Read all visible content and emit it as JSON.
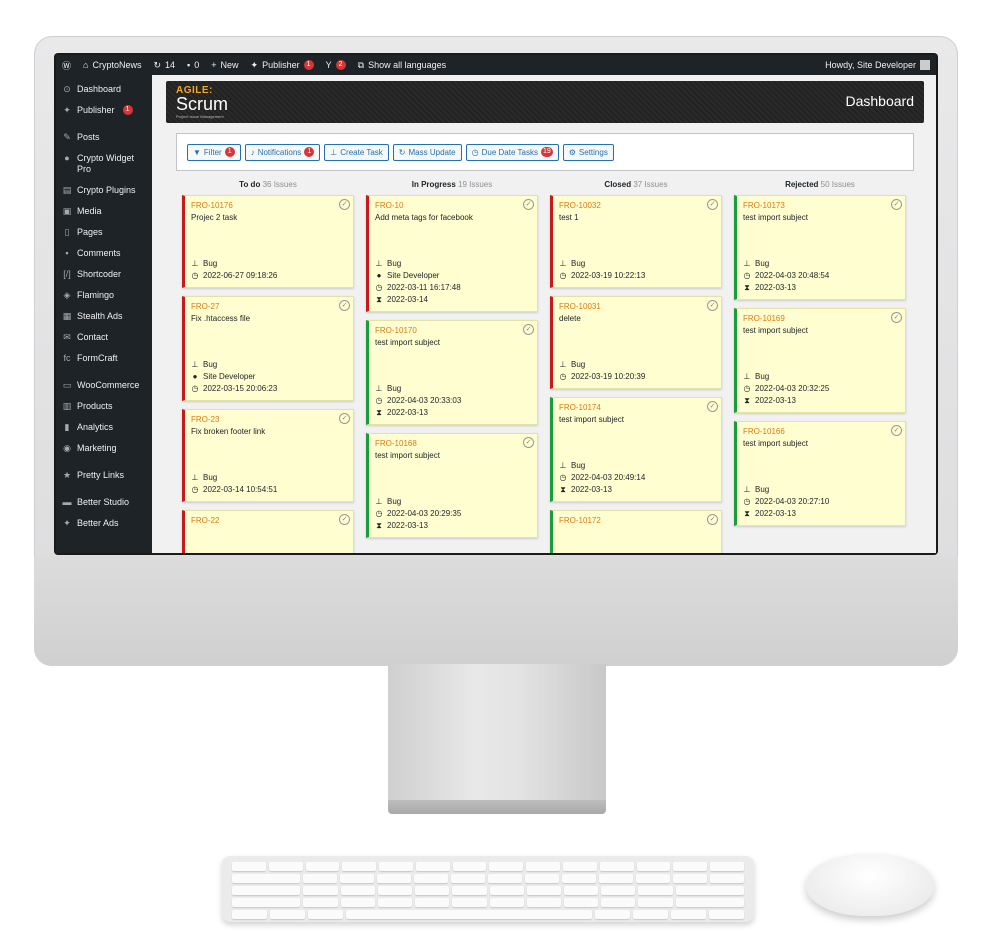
{
  "adminbar": {
    "site_name": "CryptoNews",
    "updates_count": "14",
    "comments_count": "0",
    "new_label": "New",
    "publisher_label": "Publisher",
    "publisher_badge": "1",
    "yoast_badge": "2",
    "languages_label": "Show all languages",
    "howdy": "Howdy, Site Developer"
  },
  "sidebar": {
    "items": [
      {
        "label": "Dashboard",
        "icon": "dashboard-icon",
        "glyph": "⊙"
      },
      {
        "label": "Publisher",
        "icon": "publisher-icon",
        "glyph": "✦",
        "badge": "1"
      },
      {
        "label": "Posts",
        "icon": "pin-icon",
        "glyph": "✎"
      },
      {
        "label": "Crypto Widget Pro",
        "icon": "crypto-icon",
        "glyph": "●"
      },
      {
        "label": "Crypto Plugins",
        "icon": "folder-icon",
        "glyph": "▤"
      },
      {
        "label": "Media",
        "icon": "media-icon",
        "glyph": "▣"
      },
      {
        "label": "Pages",
        "icon": "pages-icon",
        "glyph": "▯"
      },
      {
        "label": "Comments",
        "icon": "comments-icon",
        "glyph": "▪"
      },
      {
        "label": "Shortcoder",
        "icon": "shortcode-icon",
        "glyph": "[/]"
      },
      {
        "label": "Flamingo",
        "icon": "flamingo-icon",
        "glyph": "◈"
      },
      {
        "label": "Stealth Ads",
        "icon": "ads-icon",
        "glyph": "▦"
      },
      {
        "label": "Contact",
        "icon": "mail-icon",
        "glyph": "✉"
      },
      {
        "label": "FormCraft",
        "icon": "formcraft-icon",
        "glyph": "fc"
      },
      {
        "label": "WooCommerce",
        "icon": "woo-icon",
        "glyph": "▭"
      },
      {
        "label": "Products",
        "icon": "products-icon",
        "glyph": "▥"
      },
      {
        "label": "Analytics",
        "icon": "analytics-icon",
        "glyph": "▮"
      },
      {
        "label": "Marketing",
        "icon": "marketing-icon",
        "glyph": "◉"
      },
      {
        "label": "Pretty Links",
        "icon": "link-icon",
        "glyph": "★"
      },
      {
        "label": "Better Studio",
        "icon": "studio-icon",
        "glyph": "▬"
      },
      {
        "label": "Better Ads",
        "icon": "better-ads-icon",
        "glyph": "✦"
      }
    ]
  },
  "banner": {
    "logo_top": "AGILE:",
    "logo_main": "Scrum",
    "logo_sub": "Project Issue Management",
    "title": "Dashboard"
  },
  "toolbar": {
    "filter": "Filter",
    "filter_badge": "1",
    "notifications": "Notifications",
    "notifications_badge": "1",
    "create_task": "Create Task",
    "mass_update": "Mass Update",
    "due_date": "Due Date Tasks",
    "due_badge": "19",
    "settings": "Settings"
  },
  "columns": [
    {
      "title": "To do",
      "count": "36 Issues",
      "cards": [
        {
          "id": "FRO-10176",
          "subject": "Projec 2 task",
          "type": "Bug",
          "created": "2022-06-27 09:18:26",
          "color": "red"
        },
        {
          "id": "FRO-27",
          "subject": "Fix .htaccess file",
          "type": "Bug",
          "assignee": "Site Developer",
          "created": "2022-03-15 20:06:23",
          "color": "red"
        },
        {
          "id": "FRO-23",
          "subject": "Fix broken footer link",
          "type": "Bug",
          "created": "2022-03-14 10:54:51",
          "color": "red"
        },
        {
          "id": "FRO-22",
          "subject": "",
          "type": "",
          "created": "",
          "color": "red"
        }
      ]
    },
    {
      "title": "In Progress",
      "count": "19 Issues",
      "cards": [
        {
          "id": "FRO-10",
          "subject": "Add meta tags for facebook",
          "type": "Bug",
          "assignee": "Site Developer",
          "created": "2022-03-11 16:17:48",
          "due": "2022-03-14",
          "color": "red"
        },
        {
          "id": "FRO-10170",
          "subject": "test import subject",
          "type": "Bug",
          "created": "2022-04-03 20:33:03",
          "due": "2022-03-13",
          "color": "green"
        },
        {
          "id": "FRO-10168",
          "subject": "test import subject",
          "type": "Bug",
          "created": "2022-04-03 20:29:35",
          "due": "2022-03-13",
          "color": "green"
        }
      ]
    },
    {
      "title": "Closed",
      "count": "37 Issues",
      "cards": [
        {
          "id": "FRO-10032",
          "subject": "test 1",
          "type": "Bug",
          "created": "2022-03-19 10:22:13",
          "color": "red"
        },
        {
          "id": "FRO-10031",
          "subject": "delete",
          "type": "Bug",
          "created": "2022-03-19 10:20:39",
          "color": "red"
        },
        {
          "id": "FRO-10174",
          "subject": "test import subject",
          "type": "Bug",
          "created": "2022-04-03 20:49:14",
          "due": "2022-03-13",
          "color": "green"
        },
        {
          "id": "FRO-10172",
          "subject": "",
          "type": "",
          "created": "",
          "color": "green"
        }
      ]
    },
    {
      "title": "Rejected",
      "count": "50 Issues",
      "cards": [
        {
          "id": "FRO-10173",
          "subject": "test import subject",
          "type": "Bug",
          "created": "2022-04-03 20:48:54",
          "due": "2022-03-13",
          "color": "green"
        },
        {
          "id": "FRO-10169",
          "subject": "test import subject",
          "type": "Bug",
          "created": "2022-04-03 20:32:25",
          "due": "2022-03-13",
          "color": "green"
        },
        {
          "id": "FRO-10166",
          "subject": "test import subject",
          "type": "Bug",
          "created": "2022-04-03 20:27:10",
          "due": "2022-03-13",
          "color": "green"
        }
      ]
    }
  ]
}
